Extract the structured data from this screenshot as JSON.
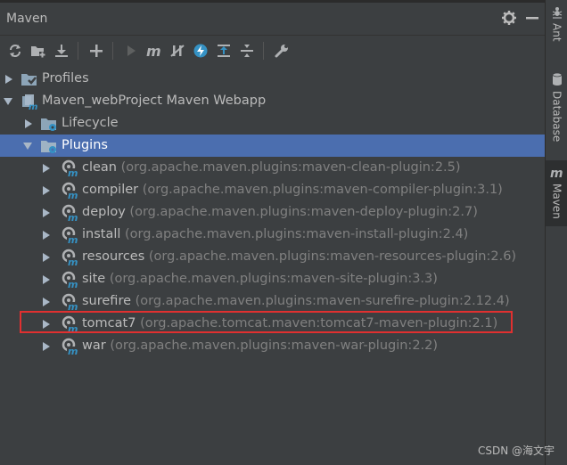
{
  "panel": {
    "title": "Maven"
  },
  "toolbar": {
    "icons": [
      "refresh-icon",
      "add-folder-icon",
      "download-icon",
      "add-icon",
      "run-icon",
      "maven-goal-icon",
      "skip-tests-icon",
      "offline-icon",
      "show-dependencies-icon",
      "collapse-all-icon",
      "settings-wrench-icon"
    ]
  },
  "tree": {
    "profiles": "Profiles",
    "project": "Maven_webProject Maven Webapp",
    "lifecycle": "Lifecycle",
    "plugins_label": "Plugins",
    "plugins": [
      {
        "name": "clean",
        "detail": "(org.apache.maven.plugins:maven-clean-plugin:2.5)"
      },
      {
        "name": "compiler",
        "detail": "(org.apache.maven.plugins:maven-compiler-plugin:3.1)"
      },
      {
        "name": "deploy",
        "detail": "(org.apache.maven.plugins:maven-deploy-plugin:2.7)"
      },
      {
        "name": "install",
        "detail": "(org.apache.maven.plugins:maven-install-plugin:2.4)"
      },
      {
        "name": "resources",
        "detail": "(org.apache.maven.plugins:maven-resources-plugin:2.6)"
      },
      {
        "name": "site",
        "detail": "(org.apache.maven.plugins:maven-site-plugin:3.3)"
      },
      {
        "name": "surefire",
        "detail": "(org.apache.maven.plugins:maven-surefire-plugin:2.12.4)"
      },
      {
        "name": "tomcat7",
        "detail": "(org.apache.tomcat.maven:tomcat7-maven-plugin:2.1)"
      },
      {
        "name": "war",
        "detail": "(org.apache.maven.plugins:maven-war-plugin:2.2)"
      }
    ]
  },
  "side_tabs": {
    "ant": "Ant",
    "database": "Database",
    "maven": "Maven"
  },
  "watermark": "CSDN @海文宇",
  "colors": {
    "background": "#3c3f41",
    "selection": "#4b6eaf",
    "highlight_border": "#e03030",
    "detail_text": "#808080"
  }
}
